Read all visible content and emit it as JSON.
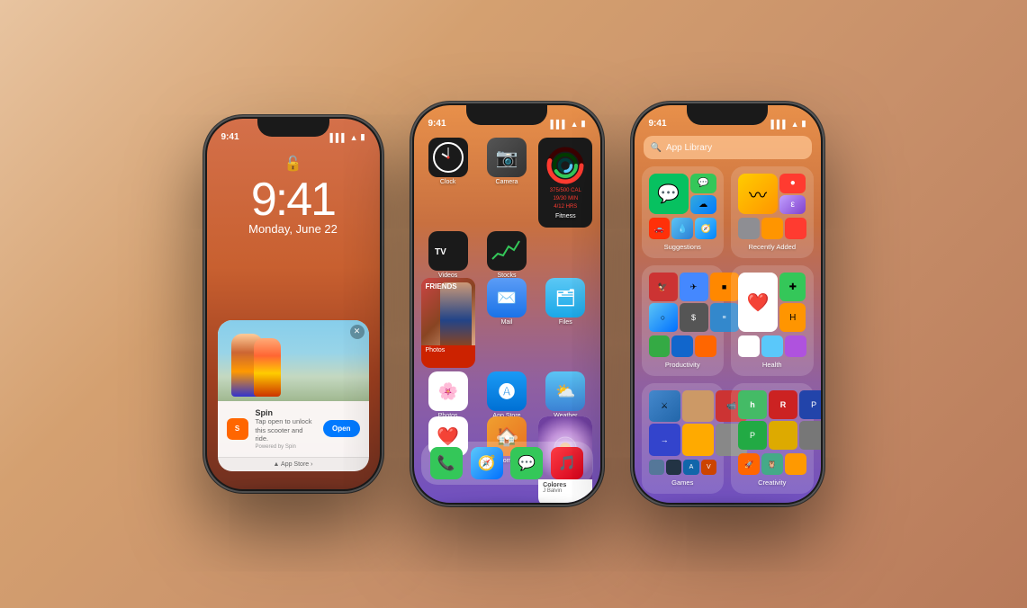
{
  "page": {
    "bg": "warm gradient background"
  },
  "phone_left": {
    "status_time": "9:41",
    "lock_time": "9:41",
    "lock_date": "Monday, June 22",
    "notification": {
      "app_name": "Spin",
      "title": "Spin",
      "description": "Tap open to unlock this scooter and ride.",
      "powered_by": "Powered by Spin",
      "button_label": "Open",
      "appstore_link": "▲ App Store ›"
    }
  },
  "phone_center": {
    "status_time": "9:41",
    "apps": [
      "Clock",
      "Camera",
      "Fitness",
      "Videos",
      "Stocks",
      "",
      "Photos",
      "Mail",
      "Files",
      "Photos",
      "App Store",
      "Weather",
      "Health",
      "Home",
      "Music",
      "Podcasts",
      "Photos",
      ""
    ],
    "music_title": "Colores",
    "music_artist": "J Balvin",
    "fitness_cal": "375/500 CAL",
    "fitness_min": "19/30 MIN",
    "fitness_hrs": "4/12 HRS",
    "friends_label": "FRIENDS",
    "dock_apps": [
      "Phone",
      "Safari",
      "Messages",
      "Music"
    ]
  },
  "phone_right": {
    "status_time": "9:41",
    "search_placeholder": "App Library",
    "folders": [
      {
        "label": "Suggestions",
        "apps": [
          "wechat",
          "messages",
          "cloud",
          "doordash",
          "droplet",
          "safari",
          "squiggly",
          "epi",
          "extra"
        ]
      },
      {
        "label": "Recently Added",
        "apps": [
          "gray",
          "orange",
          "red",
          "blue",
          "purple",
          "teal",
          "yellow",
          "green",
          "brown"
        ]
      },
      {
        "label": "Productivity",
        "apps": [
          "bird",
          "plane",
          "orange-app",
          "teal-circ",
          "dollar-box",
          "lines-app",
          "map-app",
          "num-app"
        ]
      },
      {
        "label": "Health",
        "apps": [
          "red-h",
          "green-cross",
          "orange-h",
          "white-h",
          "blue-h",
          "purple-h"
        ]
      },
      {
        "label": "Games",
        "apps": [
          "clash",
          "tan",
          "vid-cam",
          "arrow",
          "face-app",
          "camera-app",
          "mountain",
          "lr-app",
          "a-blue",
          "letter-v"
        ]
      },
      {
        "label": "Creativity",
        "apps": [
          "houzz",
          "red-r",
          "blue-p",
          "green-p",
          "yellow-p",
          "camera-cr",
          "rocket",
          "owl",
          "extra2"
        ]
      }
    ]
  }
}
